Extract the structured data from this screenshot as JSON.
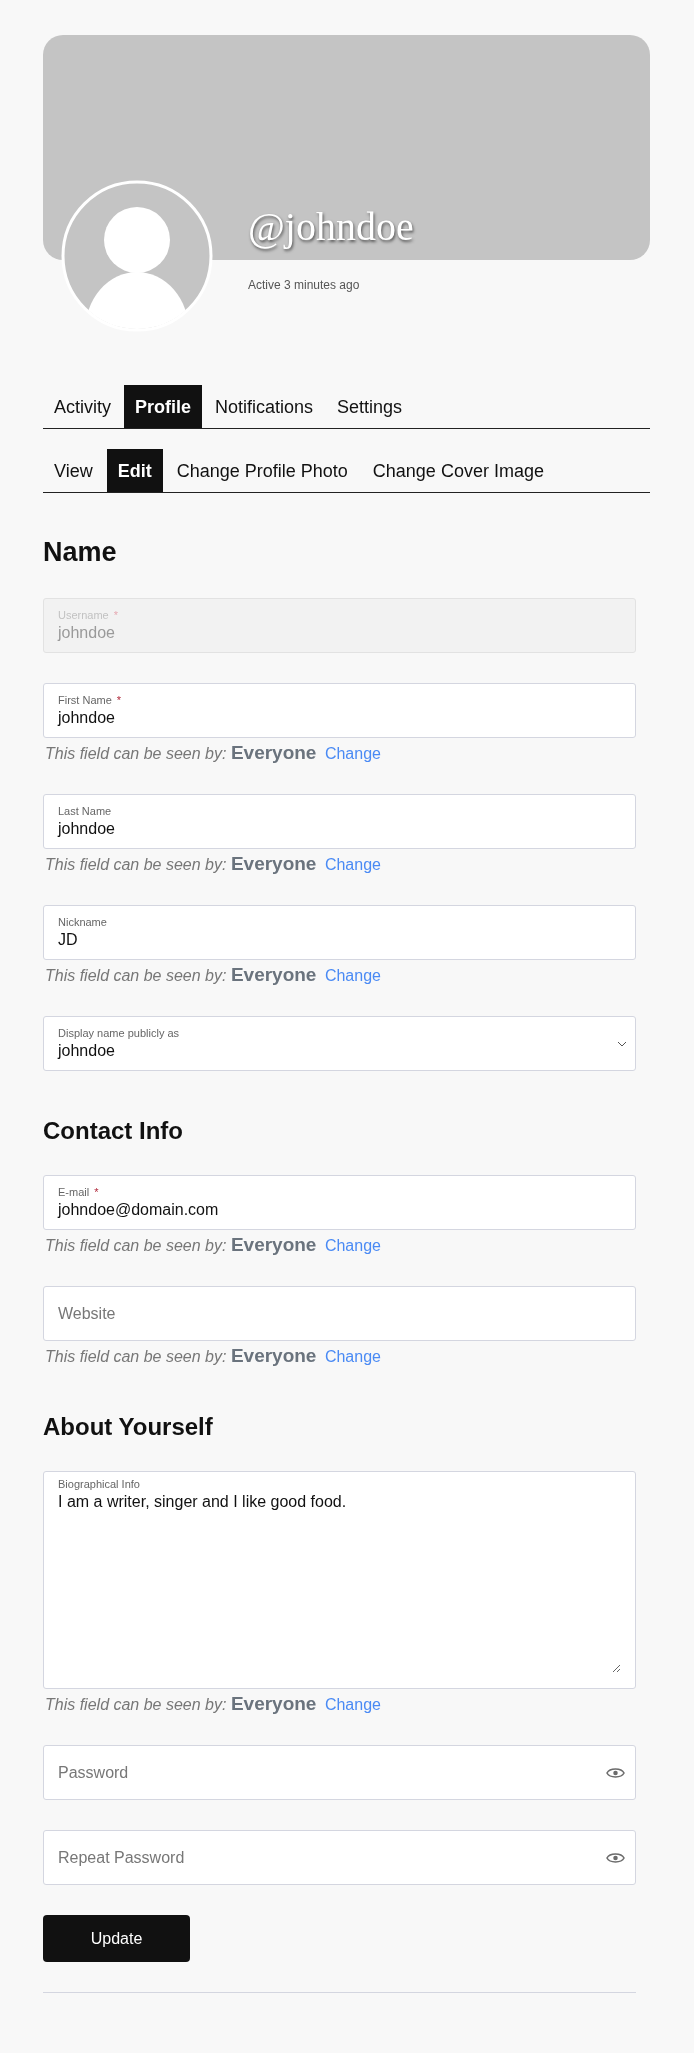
{
  "profile": {
    "username": "@johndoe",
    "last_active": "Active 3 minutes ago"
  },
  "tabs": [
    {
      "label": "Activity",
      "selected": false
    },
    {
      "label": "Profile",
      "selected": true
    },
    {
      "label": "Notifications",
      "selected": false
    },
    {
      "label": "Settings",
      "selected": false
    }
  ],
  "subtabs": [
    {
      "label": "View",
      "selected": false
    },
    {
      "label": "Edit",
      "selected": true
    },
    {
      "label": "Change Profile Photo",
      "selected": false
    },
    {
      "label": "Change Cover Image",
      "selected": false
    }
  ],
  "sections": [
    {
      "heading": "Name",
      "fields": [
        {
          "kind": "text",
          "label": "Username",
          "required_mark": "*",
          "disabled": true,
          "value": "johndoe"
        },
        {
          "kind": "text",
          "label": "First Name",
          "required_mark": "*",
          "disabled": false,
          "value": "johndoe",
          "visibility": {
            "text": "This field can be seen by:",
            "audience": "Everyone",
            "link": "Change"
          }
        },
        {
          "kind": "text",
          "label": "Last Name",
          "disabled": false,
          "value": "johndoe",
          "visibility": {
            "text": "This field can be seen by:",
            "audience": "Everyone",
            "link": "Change"
          }
        },
        {
          "kind": "text",
          "label": "Nickname",
          "disabled": false,
          "value": "JD",
          "visibility": {
            "text": "This field can be seen by:",
            "audience": "Everyone",
            "link": "Change"
          }
        },
        {
          "kind": "select",
          "label": "Display name publicly as",
          "disabled": false,
          "value": "johndoe"
        }
      ]
    },
    {
      "heading": "Contact Info",
      "fields": [
        {
          "kind": "text",
          "label": "E-mail",
          "required_mark": "*",
          "disabled": false,
          "value": "johndoe@domain.com",
          "visibility": {
            "text": "This field can be seen by:",
            "audience": "Everyone",
            "link": "Change"
          }
        },
        {
          "kind": "text",
          "placeholder": "Website",
          "disabled": false,
          "visibility": {
            "text": "This field can be seen by:",
            "audience": "Everyone",
            "link": "Change"
          }
        }
      ]
    },
    {
      "heading": "About Yourself",
      "fields": [
        {
          "kind": "textarea",
          "label": "Biographical Info",
          "disabled": false,
          "value": "I am a writer, singer and I like good food.",
          "visibility": {
            "text": "This field can be seen by:",
            "audience": "Everyone",
            "link": "Change"
          }
        },
        {
          "kind": "password",
          "placeholder": "Password",
          "disabled": false
        },
        {
          "kind": "password",
          "placeholder": "Repeat Password",
          "disabled": false
        }
      ]
    }
  ],
  "submit": "Update"
}
